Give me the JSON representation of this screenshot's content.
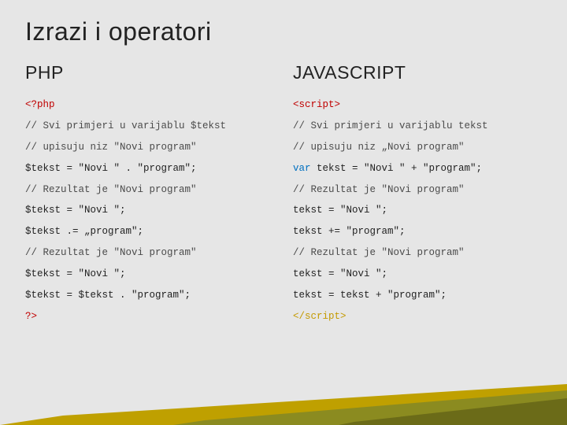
{
  "slide": {
    "title": "Izrazi i operatori",
    "left": {
      "heading": "PHP",
      "code": [
        [
          {
            "t": "<?php",
            "c": "kw-open"
          }
        ],
        [
          {
            "t": "// Svi primjeri u varijablu $tekst",
            "c": "comment"
          }
        ],
        [
          {
            "t": "// upisuju niz \"Novi program\"",
            "c": "comment"
          }
        ],
        [
          {
            "t": "$tekst = \"Novi \" . \"program\"; "
          }
        ],
        [
          {
            "t": "// Rezultat je \"Novi program\"",
            "c": "comment"
          }
        ],
        [
          {
            "t": "$tekst = \"Novi \"; "
          }
        ],
        [
          {
            "t": "$tekst .= „program\"; "
          }
        ],
        [
          {
            "t": "// Rezultat je \"Novi program\"",
            "c": "comment"
          }
        ],
        [
          {
            "t": "$tekst = \"Novi \"; "
          }
        ],
        [
          {
            "t": "$tekst = $tekst . \"program\"; "
          }
        ],
        [
          {
            "t": "?>",
            "c": "kw-open"
          }
        ]
      ]
    },
    "right": {
      "heading": "JAVASCRIPT",
      "code": [
        [
          {
            "t": "<script>",
            "c": "kw-open"
          }
        ],
        [
          {
            "t": "// Svi primjeri u varijablu tekst",
            "c": "comment"
          }
        ],
        [
          {
            "t": "// upisuju niz „Novi program\"",
            "c": "comment"
          }
        ],
        [
          {
            "t": "var",
            "c": "kw-blue"
          },
          {
            "t": " tekst = \"Novi \" + \"program\"; "
          }
        ],
        [
          {
            "t": "// Rezultat je \"Novi program\"",
            "c": "comment"
          }
        ],
        [
          {
            "t": "tekst = \"Novi \"; "
          }
        ],
        [
          {
            "t": "tekst += \"program\"; "
          }
        ],
        [
          {
            "t": "// Rezultat je \"Novi program\"",
            "c": "comment"
          }
        ],
        [
          {
            "t": "tekst = \"Novi \"; "
          }
        ],
        [
          {
            "t": "tekst = tekst + \"program\"; "
          }
        ],
        [
          {
            "t": "</script>",
            "c": "kw-close"
          }
        ]
      ]
    }
  }
}
